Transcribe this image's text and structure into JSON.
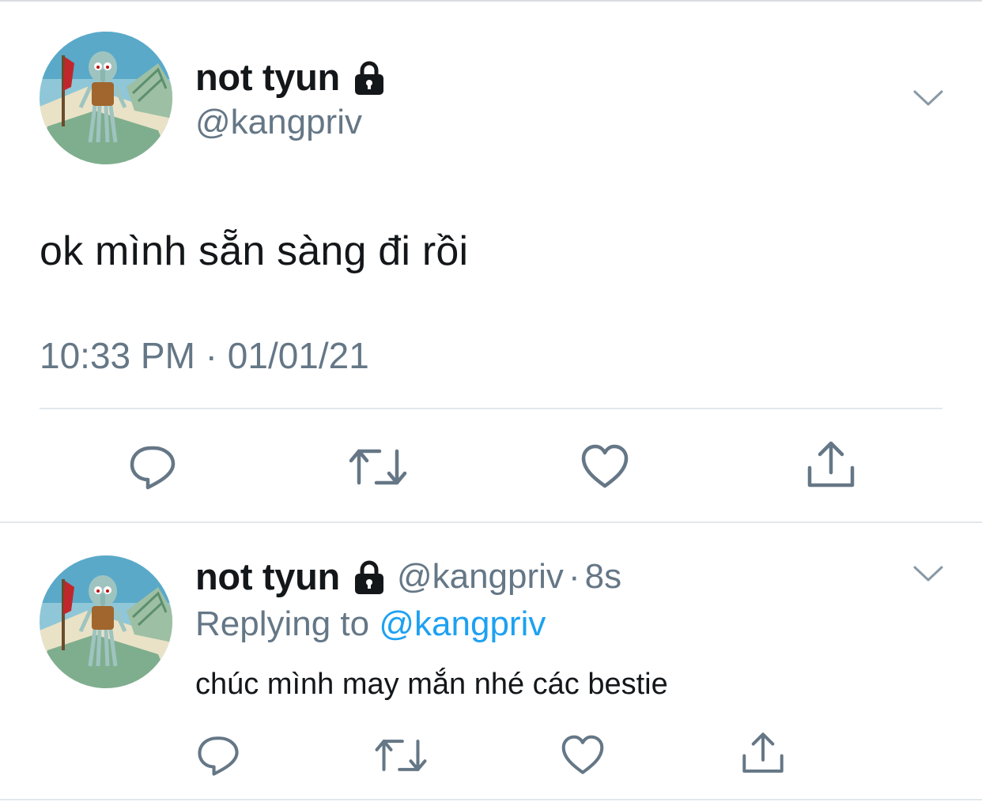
{
  "main_tweet": {
    "display_name": "not tyun",
    "handle": "@kangpriv",
    "text": "ok mình sẵn sàng đi rồi",
    "timestamp": "10:33 PM · 01/01/21",
    "icons": {
      "protected": "lock-icon",
      "menu": "chevron-down-icon",
      "reply": "reply-icon",
      "retweet": "retweet-icon",
      "like": "heart-icon",
      "share": "share-icon"
    }
  },
  "reply_tweet": {
    "display_name": "not tyun",
    "handle": "@kangpriv",
    "separator": "·",
    "age": "8s",
    "replying_to_label": "Replying to",
    "replying_to_handle": "@kangpriv",
    "text": "chúc mình may mắn nhé các bestie"
  },
  "colors": {
    "text_primary": "#14171a",
    "text_secondary": "#657786",
    "link": "#1da1f2",
    "divider": "#e1e8ed"
  }
}
